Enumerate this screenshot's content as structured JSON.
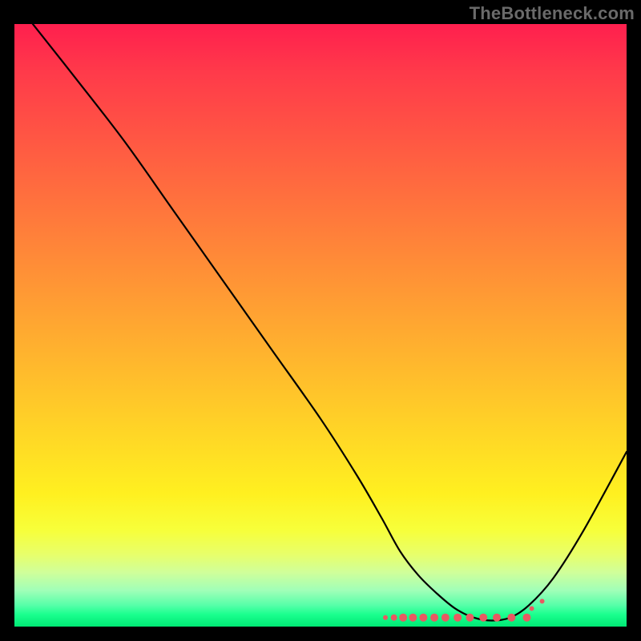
{
  "watermark": "TheBottleneck.com",
  "chart_data": {
    "type": "line",
    "title": "",
    "xlabel": "",
    "ylabel": "",
    "xlim": [
      0,
      100
    ],
    "ylim": [
      0,
      100
    ],
    "gradient_background": true,
    "series": [
      {
        "name": "bottleneck-curve",
        "x": [
          3,
          10,
          18,
          26,
          34,
          42,
          50,
          56,
          60,
          63,
          66,
          69,
          72,
          75,
          78,
          81,
          84,
          88,
          93,
          100
        ],
        "y": [
          100,
          91,
          80.5,
          69,
          57.5,
          46,
          34.5,
          25,
          18,
          12.5,
          8.5,
          5.5,
          3,
          1.5,
          1,
          1.5,
          3.5,
          8,
          16,
          29
        ],
        "stroke": "#000000",
        "width": 2.2
      }
    ],
    "markers": {
      "name": "bottleneck-optimal-zone",
      "color": "#e85a62",
      "x": [
        60.6,
        62.0,
        63.5,
        65.1,
        66.8,
        68.6,
        70.4,
        72.4,
        74.4,
        76.6,
        78.8,
        81.2,
        83.7,
        84.5,
        86.2
      ],
      "y": [
        1.5,
        1.5,
        1.5,
        1.5,
        1.5,
        1.5,
        1.5,
        1.5,
        1.5,
        1.5,
        1.5,
        1.5,
        1.5,
        3.0,
        4.2
      ],
      "sizes": [
        3,
        4,
        5,
        5,
        5,
        5,
        5,
        5,
        5,
        5,
        5,
        5,
        5,
        3,
        3
      ]
    }
  }
}
